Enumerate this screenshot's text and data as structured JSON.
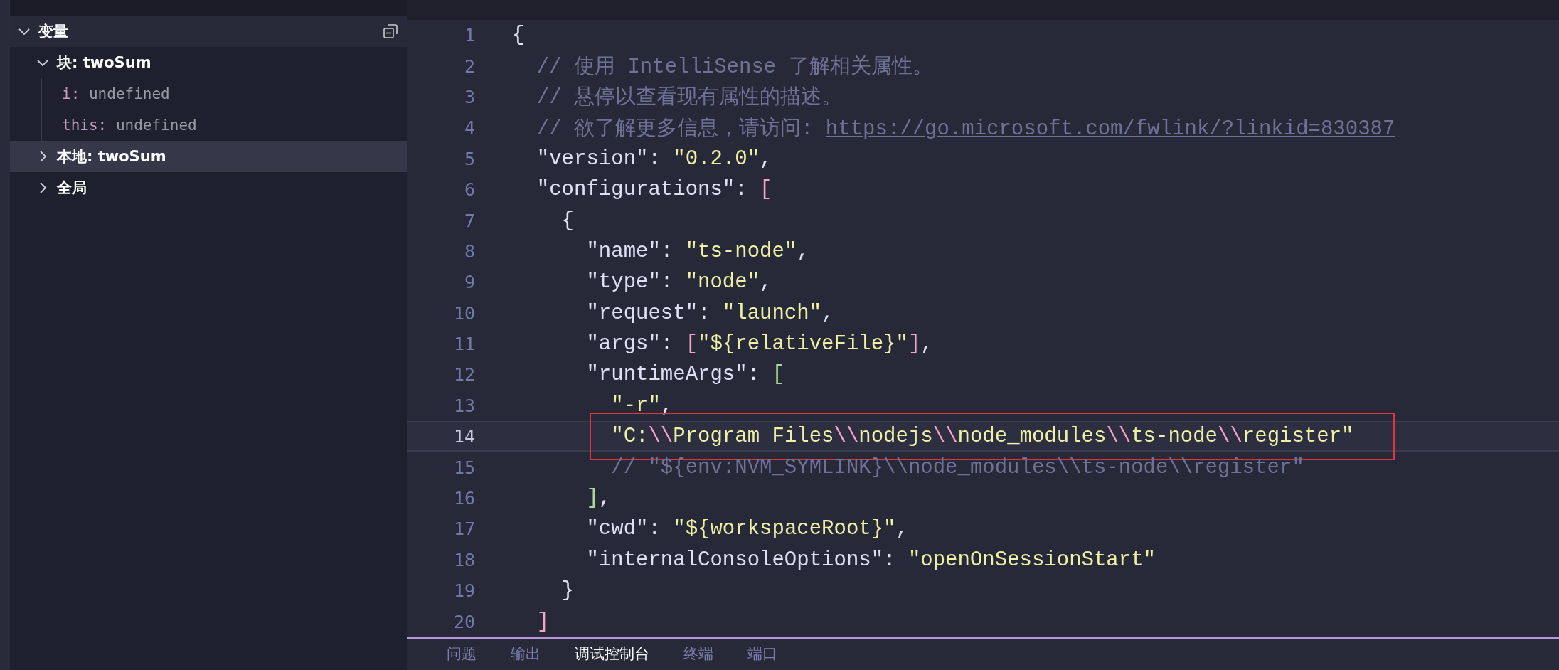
{
  "variables_panel": {
    "title": "变量",
    "sections": [
      {
        "label": "块: twoSum",
        "expanded": true,
        "selected": false,
        "children": [
          {
            "name": "i:",
            "value": "undefined"
          },
          {
            "name": "this:",
            "value": "undefined"
          }
        ]
      },
      {
        "label": "本地: twoSum",
        "expanded": false,
        "selected": true
      },
      {
        "label": "全局",
        "expanded": false,
        "selected": false
      }
    ]
  },
  "editor": {
    "lines": [
      {
        "number": "1",
        "current": false,
        "annotated": false,
        "tokens": [
          {
            "kind": "punct",
            "text": "{"
          }
        ]
      },
      {
        "number": "2",
        "current": false,
        "annotated": false,
        "tokens": [
          {
            "kind": "comment",
            "text": "  // 使用 IntelliSense 了解相关属性。"
          }
        ]
      },
      {
        "number": "3",
        "current": false,
        "annotated": false,
        "tokens": [
          {
            "kind": "comment",
            "text": "  // 悬停以查看现有属性的描述。"
          }
        ]
      },
      {
        "number": "4",
        "current": false,
        "annotated": false,
        "tokens": [
          {
            "kind": "comment",
            "text": "  // 欲了解更多信息，请访问: "
          },
          {
            "kind": "link",
            "text": "https://go.microsoft.com/fwlink/?linkid=830387"
          }
        ]
      },
      {
        "number": "5",
        "current": false,
        "annotated": false,
        "tokens": [
          {
            "kind": "key",
            "text": "  \"version\""
          },
          {
            "kind": "punct",
            "text": ": "
          },
          {
            "kind": "string",
            "text": "\"0.2.0\""
          },
          {
            "kind": "punct",
            "text": ","
          }
        ]
      },
      {
        "number": "6",
        "current": false,
        "annotated": false,
        "tokens": [
          {
            "kind": "key",
            "text": "  \"configurations\""
          },
          {
            "kind": "punct",
            "text": ": "
          },
          {
            "kind": "bracket",
            "text": "["
          }
        ]
      },
      {
        "number": "7",
        "current": false,
        "annotated": false,
        "tokens": [
          {
            "kind": "punct",
            "text": "    {"
          }
        ]
      },
      {
        "number": "8",
        "current": false,
        "annotated": false,
        "tokens": [
          {
            "kind": "key",
            "text": "      \"name\""
          },
          {
            "kind": "punct",
            "text": ": "
          },
          {
            "kind": "string",
            "text": "\"ts-node\""
          },
          {
            "kind": "punct",
            "text": ","
          }
        ]
      },
      {
        "number": "9",
        "current": false,
        "annotated": false,
        "tokens": [
          {
            "kind": "key",
            "text": "      \"type\""
          },
          {
            "kind": "punct",
            "text": ": "
          },
          {
            "kind": "string",
            "text": "\"node\""
          },
          {
            "kind": "punct",
            "text": ","
          }
        ]
      },
      {
        "number": "10",
        "current": false,
        "annotated": false,
        "tokens": [
          {
            "kind": "key",
            "text": "      \"request\""
          },
          {
            "kind": "punct",
            "text": ": "
          },
          {
            "kind": "string",
            "text": "\"launch\""
          },
          {
            "kind": "punct",
            "text": ","
          }
        ]
      },
      {
        "number": "11",
        "current": false,
        "annotated": false,
        "tokens": [
          {
            "kind": "key",
            "text": "      \"args\""
          },
          {
            "kind": "punct",
            "text": ": "
          },
          {
            "kind": "bracket",
            "text": "["
          },
          {
            "kind": "string",
            "text": "\"${relativeFile}\""
          },
          {
            "kind": "bracket",
            "text": "]"
          },
          {
            "kind": "punct",
            "text": ","
          }
        ]
      },
      {
        "number": "12",
        "current": false,
        "annotated": false,
        "tokens": [
          {
            "kind": "key",
            "text": "      \"runtimeArgs\""
          },
          {
            "kind": "punct",
            "text": ": "
          },
          {
            "kind": "bracket_alt",
            "text": "["
          }
        ]
      },
      {
        "number": "13",
        "current": false,
        "annotated": false,
        "tokens": [
          {
            "kind": "string",
            "text": "        \"-r\""
          },
          {
            "kind": "punct",
            "text": ","
          }
        ]
      },
      {
        "number": "14",
        "current": true,
        "annotated": true,
        "tokens": [
          {
            "kind": "string",
            "text": "        \"C:"
          },
          {
            "kind": "escape",
            "text": "\\\\"
          },
          {
            "kind": "string",
            "text": "Program Files"
          },
          {
            "kind": "escape",
            "text": "\\\\"
          },
          {
            "kind": "string",
            "text": "nodejs"
          },
          {
            "kind": "escape",
            "text": "\\\\"
          },
          {
            "kind": "string",
            "text": "node_modules"
          },
          {
            "kind": "escape",
            "text": "\\\\"
          },
          {
            "kind": "string",
            "text": "ts-node"
          },
          {
            "kind": "escape",
            "text": "\\\\"
          },
          {
            "kind": "string",
            "text": "register\""
          }
        ]
      },
      {
        "number": "15",
        "current": false,
        "annotated": false,
        "tokens": [
          {
            "kind": "comment",
            "text": "        // \"${env:NVM_SYMLINK}\\\\node_modules\\\\ts-node\\\\register\""
          }
        ]
      },
      {
        "number": "16",
        "current": false,
        "annotated": false,
        "tokens": [
          {
            "kind": "bracket_alt",
            "text": "      ]"
          },
          {
            "kind": "punct",
            "text": ","
          }
        ]
      },
      {
        "number": "17",
        "current": false,
        "annotated": false,
        "tokens": [
          {
            "kind": "key",
            "text": "      \"cwd\""
          },
          {
            "kind": "punct",
            "text": ": "
          },
          {
            "kind": "string",
            "text": "\"${workspaceRoot}\""
          },
          {
            "kind": "punct",
            "text": ","
          }
        ]
      },
      {
        "number": "18",
        "current": false,
        "annotated": false,
        "tokens": [
          {
            "kind": "key",
            "text": "      \"internalConsoleOptions\""
          },
          {
            "kind": "punct",
            "text": ": "
          },
          {
            "kind": "string",
            "text": "\"openOnSessionStart\""
          }
        ]
      },
      {
        "number": "19",
        "current": false,
        "annotated": false,
        "tokens": [
          {
            "kind": "punct",
            "text": "    }"
          }
        ]
      },
      {
        "number": "20",
        "current": false,
        "annotated": false,
        "tokens": [
          {
            "kind": "bracket",
            "text": "  ]"
          }
        ]
      }
    ]
  },
  "panel_tabs": [
    {
      "label": "问题",
      "selected": false
    },
    {
      "label": "输出",
      "selected": false
    },
    {
      "label": "调试控制台",
      "selected": true
    },
    {
      "label": "终端",
      "selected": false
    },
    {
      "label": "端口",
      "selected": false
    }
  ]
}
